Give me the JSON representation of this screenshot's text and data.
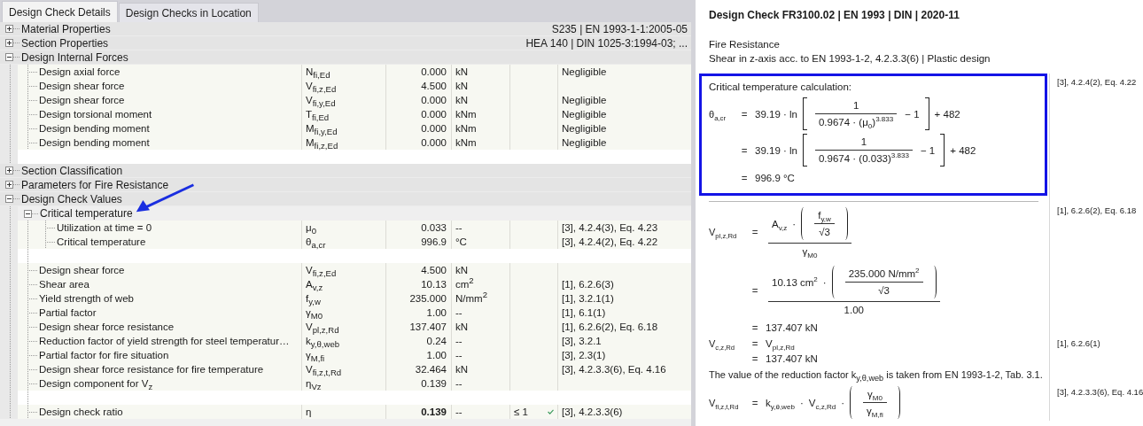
{
  "tabs": [
    {
      "label": "Design Check Details",
      "selected": true
    },
    {
      "label": "Design Checks in Location",
      "selected": false
    }
  ],
  "tree": [
    {
      "label": "Material Properties",
      "expanded": false,
      "summary": "S235 | EN 1993-1-1:2005-05"
    },
    {
      "label": "Section Properties",
      "expanded": false,
      "summary": "HEA 140 | DIN 1025-3:1994-03; ..."
    },
    {
      "label": "Design Internal Forces",
      "expanded": true,
      "children": [
        {
          "kind": "row",
          "label": "Design axial force",
          "symbol": "N$_{fi,Ed}$",
          "value": "0.000",
          "unit": "kN",
          "note": "Negligible"
        },
        {
          "kind": "row",
          "label": "Design shear force",
          "symbol": "V$_{fi,z,Ed}$",
          "value": "4.500",
          "unit": "kN"
        },
        {
          "kind": "row",
          "label": "Design shear force",
          "symbol": "V$_{fi,y,Ed}$",
          "value": "0.000",
          "unit": "kN",
          "note": "Negligible"
        },
        {
          "kind": "row",
          "label": "Design torsional moment",
          "symbol": "T$_{fi,Ed}$",
          "value": "0.000",
          "unit": "kNm",
          "note": "Negligible"
        },
        {
          "kind": "row",
          "label": "Design bending moment",
          "symbol": "M$_{fi,y,Ed}$",
          "value": "0.000",
          "unit": "kNm",
          "note": "Negligible"
        },
        {
          "kind": "row",
          "label": "Design bending moment",
          "symbol": "M$_{fi,z,Ed}$",
          "value": "0.000",
          "unit": "kNm",
          "note": "Negligible"
        },
        {
          "kind": "blank"
        }
      ]
    },
    {
      "label": "Section Classification",
      "expanded": false
    },
    {
      "label": "Parameters for Fire Resistance",
      "expanded": false
    },
    {
      "label": "Design Check Values",
      "expanded": true,
      "children": [
        {
          "kind": "group",
          "label": "Critical temperature",
          "expanded": true,
          "children": [
            {
              "kind": "row",
              "label": "Utilization at time = 0",
              "symbol": "μ$_{0}$",
              "value": "0.033",
              "unit": "--",
              "note": "[3], 4.2.4(3), Eq. 4.23"
            },
            {
              "kind": "row",
              "label": "Critical temperature",
              "symbol": "θ$_{a,cr}$",
              "value": "996.9",
              "unit": "°C",
              "note": "[3], 4.2.4(2), Eq. 4.22"
            }
          ]
        },
        {
          "kind": "blank"
        },
        {
          "kind": "row",
          "label": "Design shear force",
          "symbol": "V$_{fi,z,Ed}$",
          "value": "4.500",
          "unit": "kN"
        },
        {
          "kind": "row",
          "label": "Shear area",
          "symbol": "A$_{v,z}$",
          "value": "10.13",
          "unit": "cm$^{2}$",
          "note": "[1], 6.2.6(3)"
        },
        {
          "kind": "row",
          "label": "Yield strength of web",
          "symbol": "f$_{y,w}$",
          "value": "235.000",
          "unit": "N/mm$^{2}$",
          "note": "[1], 3.2.1(1)"
        },
        {
          "kind": "row",
          "label": "Partial factor",
          "symbol": "γ$_{M0}$",
          "value": "1.00",
          "unit": "--",
          "note": "[1], 6.1(1)"
        },
        {
          "kind": "row",
          "label": "Design shear force resistance",
          "symbol": "V$_{pl,z,Rd}$",
          "value": "137.407",
          "unit": "kN",
          "note": "[1], 6.2.6(2), Eq. 6.18"
        },
        {
          "kind": "row",
          "label": "Reduction factor of yield strength for steel temperatur…",
          "symbol": "k$_{y,θ,web}$",
          "value": "0.24",
          "unit": "--",
          "note": "[3], 3.2.1"
        },
        {
          "kind": "row",
          "label": "Partial factor for fire situation",
          "symbol": "γ$_{M,fi}$",
          "value": "1.00",
          "unit": "--",
          "note": "[3], 2.3(1)"
        },
        {
          "kind": "row",
          "label": "Design shear force resistance for fire temperature",
          "symbol": "V$_{fi,z,t,Rd}$",
          "value": "32.464",
          "unit": "kN",
          "note": "[3], 4.2.3.3(6), Eq. 4.16"
        },
        {
          "kind": "row",
          "label": "Design component for V$_{z}$",
          "symbol": "η$_{Vz}$",
          "value": "0.139",
          "unit": "--"
        },
        {
          "kind": "blank"
        },
        {
          "kind": "result",
          "label": "Design check ratio",
          "symbol": "η",
          "value": "0.139",
          "unit": "--",
          "limit": "≤ 1",
          "passed": true,
          "note": "[3], 4.2.3.3(6)"
        }
      ]
    }
  ],
  "report": {
    "title": "Design Check FR3100.02 | EN 1993 | DIN | 2020-11",
    "subtitle": [
      "Fire Resistance",
      "Shear in z-axis acc. to EN 1993-1-2, 4.2.3.3(6) | Plastic design"
    ],
    "sections": [
      {
        "kind": "boxed_equation",
        "heading": "Critical temperature calculation:",
        "reference": "[3], 4.2.4(2), Eq. 4.22",
        "lines": [
          {
            "lhs": "θ$_{a,cr}$",
            "eq": "=",
            "parts": [
              {
                "kind": "text",
                "text": "39.19 · ln"
              },
              {
                "kind": "bracket",
                "parts": [
                  {
                    "kind": "frac",
                    "num": [
                      {
                        "kind": "text",
                        "text": "1"
                      }
                    ],
                    "den": [
                      {
                        "kind": "text",
                        "text": "0.9674 · (μ$_{0}$)$^{3.833}$"
                      }
                    ]
                  },
                  {
                    "kind": "text",
                    "text": "− 1"
                  }
                ]
              },
              {
                "kind": "text",
                "text": "+ 482"
              }
            ]
          },
          {
            "eq": "=",
            "parts": [
              {
                "kind": "text",
                "text": "39.19 · ln"
              },
              {
                "kind": "bracket",
                "parts": [
                  {
                    "kind": "frac",
                    "num": [
                      {
                        "kind": "text",
                        "text": "1"
                      }
                    ],
                    "den": [
                      {
                        "kind": "text",
                        "text": "0.9674 · (0.033)$^{3.833}$"
                      }
                    ]
                  },
                  {
                    "kind": "text",
                    "text": "− 1"
                  }
                ]
              },
              {
                "kind": "text",
                "text": "+ 482"
              }
            ]
          },
          {
            "eq": "=",
            "parts": [
              {
                "kind": "text",
                "text": "996.9 °C"
              }
            ]
          }
        ]
      },
      {
        "kind": "equation",
        "reference": "[1], 6.2.6(2), Eq. 6.18",
        "lines": [
          {
            "lhs": "V$_{pl,z,Rd}$",
            "eq": "=",
            "parts": [
              {
                "kind": "frac",
                "num": [
                  {
                    "kind": "text",
                    "text": "A$_{v,z}$"
                  },
                  {
                    "kind": "text",
                    "text": "·"
                  },
                  {
                    "kind": "paren",
                    "parts": [
                      {
                        "kind": "frac",
                        "num": [
                          {
                            "kind": "text",
                            "text": "f$_{y,w}$"
                          }
                        ],
                        "den": [
                          {
                            "kind": "text",
                            "text": "√3"
                          }
                        ]
                      }
                    ]
                  }
                ],
                "den": [
                  {
                    "kind": "text",
                    "text": "γ$_{M0}$"
                  }
                ]
              }
            ]
          },
          {
            "eq": "=",
            "parts": [
              {
                "kind": "frac",
                "num": [
                  {
                    "kind": "text",
                    "text": "10.13 cm$^{2}$"
                  },
                  {
                    "kind": "text",
                    "text": "·"
                  },
                  {
                    "kind": "paren",
                    "parts": [
                      {
                        "kind": "frac",
                        "num": [
                          {
                            "kind": "text",
                            "text": "235.000 N/mm$^{2}$"
                          }
                        ],
                        "den": [
                          {
                            "kind": "text",
                            "text": "√3"
                          }
                        ]
                      }
                    ]
                  }
                ],
                "den": [
                  {
                    "kind": "text",
                    "text": "1.00"
                  }
                ]
              }
            ]
          },
          {
            "eq": "=",
            "parts": [
              {
                "kind": "text",
                "text": "137.407 kN"
              }
            ]
          }
        ]
      },
      {
        "kind": "equation",
        "reference": "[1], 6.2.6(1)",
        "lines": [
          {
            "lhs": "V$_{c,z,Rd}$",
            "eq": "=",
            "parts": [
              {
                "kind": "text",
                "text": "V$_{pl,z,Rd}$"
              }
            ]
          },
          {
            "eq": "=",
            "parts": [
              {
                "kind": "text",
                "text": "137.407 kN"
              }
            ]
          }
        ]
      },
      {
        "kind": "text",
        "text": "The value of the reduction factor k$_{y,θ,web}$ is taken from EN 1993-1-2, Tab. 3.1."
      },
      {
        "kind": "equation",
        "reference": "[3], 4.2.3.3(6), Eq. 4.16",
        "lines": [
          {
            "lhs": "V$_{fi,z,t,Rd}$",
            "eq": "=",
            "parts": [
              {
                "kind": "text",
                "text": "k$_{y,θ,web}$"
              },
              {
                "kind": "text",
                "text": "·"
              },
              {
                "kind": "text",
                "text": "V$_{c,z,Rd}$"
              },
              {
                "kind": "text",
                "text": "·"
              },
              {
                "kind": "paren",
                "parts": [
                  {
                    "kind": "frac",
                    "num": [
                      {
                        "kind": "text",
                        "text": "γ$_{M0}$"
                      }
                    ],
                    "den": [
                      {
                        "kind": "text",
                        "text": "γ$_{M,fi}$"
                      }
                    ]
                  }
                ]
              }
            ]
          }
        ]
      }
    ]
  }
}
